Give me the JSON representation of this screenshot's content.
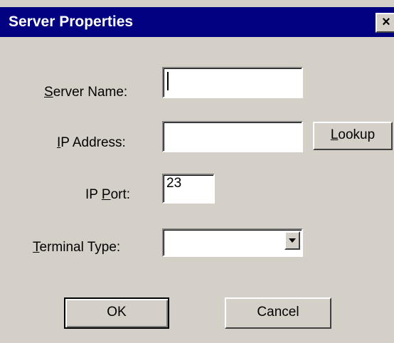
{
  "window": {
    "title": "Server Properties",
    "close_glyph": "×"
  },
  "form": {
    "server_name": {
      "label_mnemonic": "S",
      "label_rest": "erver Name:",
      "value": ""
    },
    "ip_address": {
      "label_mnemonic": "I",
      "label_rest": "P Address:",
      "value": ""
    },
    "ip_port": {
      "label_prefix": "IP ",
      "label_mnemonic": "P",
      "label_rest": "ort:",
      "value": "23"
    },
    "terminal_type": {
      "label_mnemonic": "T",
      "label_rest": "erminal Type:",
      "selected": ""
    }
  },
  "buttons": {
    "lookup_mnemonic": "L",
    "lookup_rest": "ookup",
    "ok": "OK",
    "cancel": "Cancel"
  },
  "icons": {
    "close": "close-icon",
    "dropdown": "chevron-down-icon"
  }
}
